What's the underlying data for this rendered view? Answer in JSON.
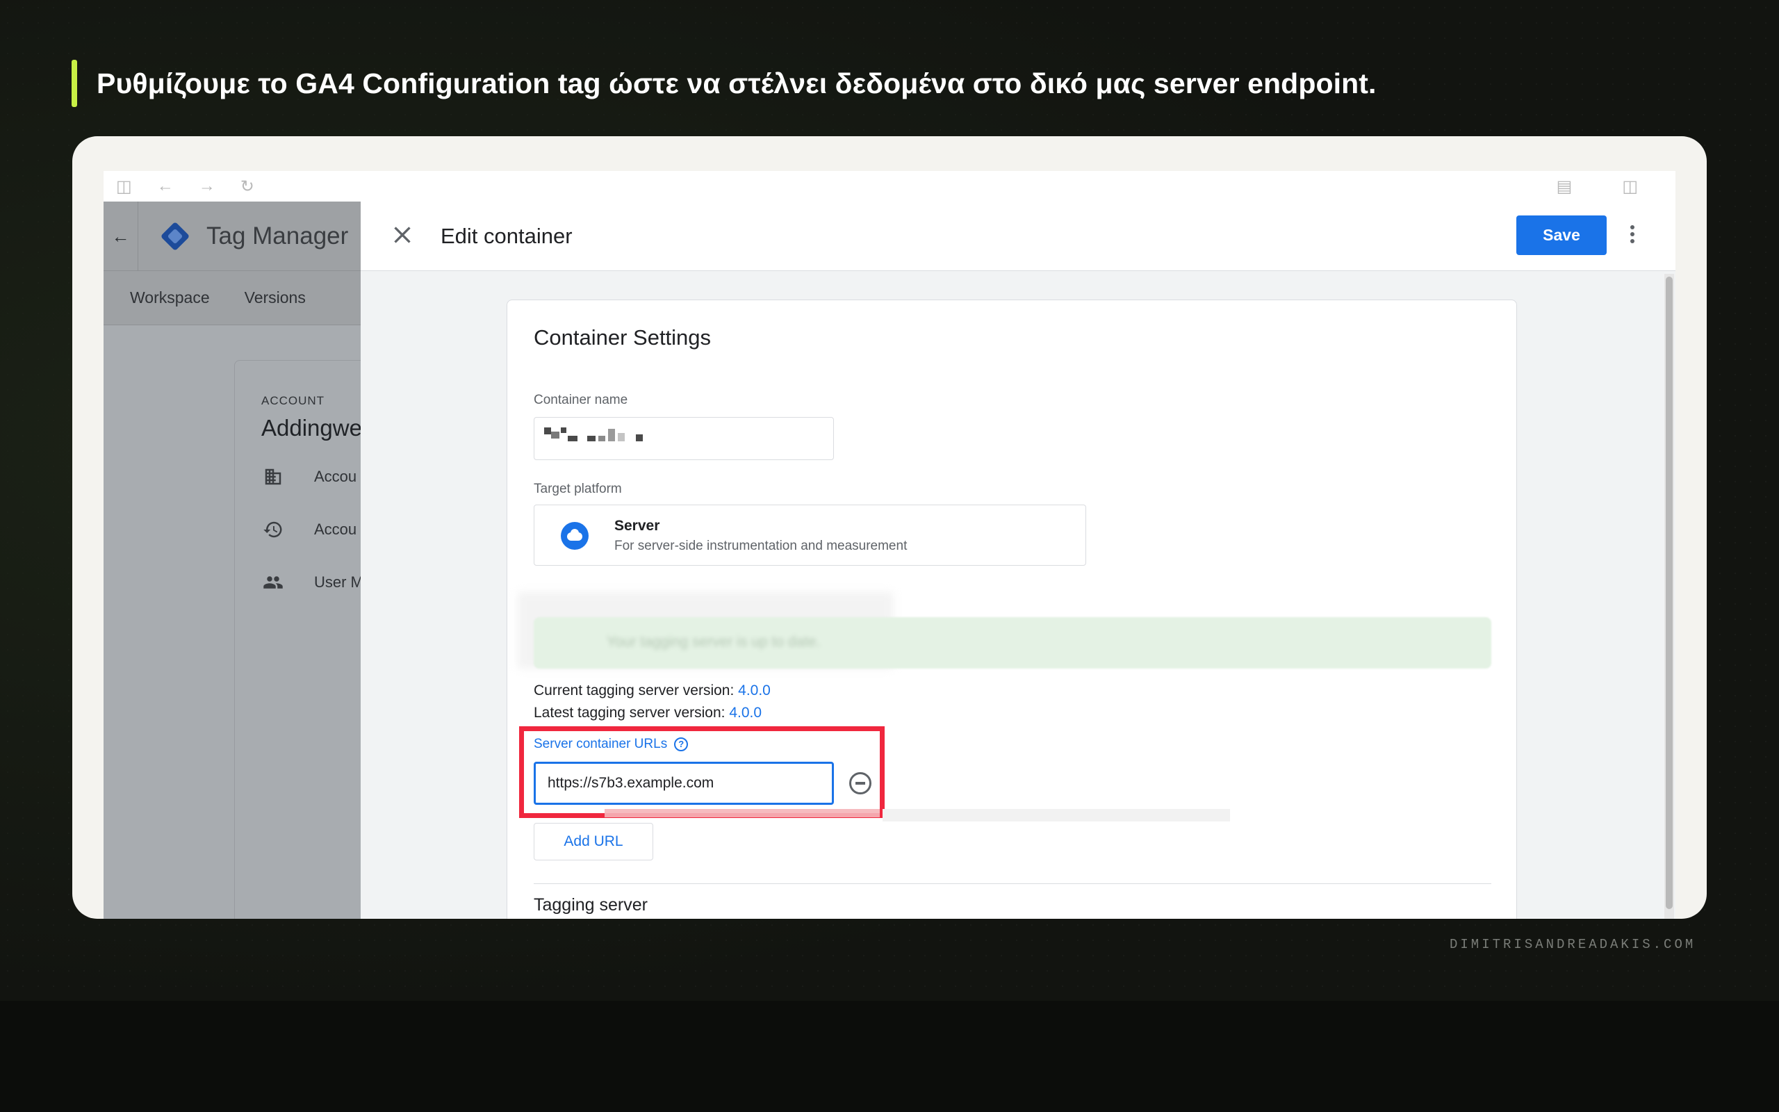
{
  "headline": "Ρυθμίζουμε το GA4 Configuration tag ώστε να στέλνει δεδομένα στο δικό μας server endpoint.",
  "watermark": "DIMITRISANDREADAKIS.COM",
  "colors": {
    "accent_bar": "#c8f045",
    "primary_blue": "#1a73e8",
    "highlight_red": "#f0273e"
  },
  "browser": {
    "toolbar_icons": [
      "sidebar-icon",
      "back-arrow-icon",
      "forward-arrow-icon",
      "reload-icon",
      "extensions-icon",
      "reader-icon"
    ]
  },
  "background_app": {
    "app_name": "Tag Manager",
    "tabs": [
      "Workspace",
      "Versions"
    ],
    "account_label": "ACCOUNT",
    "account_name": "Addingwe",
    "menu": [
      {
        "icon": "building-icon",
        "label": "Accou"
      },
      {
        "icon": "history-icon",
        "label": "Accou"
      },
      {
        "icon": "users-icon",
        "label": "User M"
      }
    ]
  },
  "edit_panel": {
    "title": "Edit container",
    "save_label": "Save",
    "settings": {
      "heading": "Container Settings",
      "container_name_label": "Container name",
      "target_platform_label": "Target platform",
      "platform_name": "Server",
      "platform_description": "For server-side instrumentation and measurement",
      "banner_text": "Your tagging server is up to date.",
      "current_version_label": "Current tagging server version:",
      "current_version": "4.0.0",
      "latest_version_label": "Latest tagging server version:",
      "latest_version": "4.0.0",
      "urls_label": "Server container URLs",
      "url_value": "https://s7b3.example.com",
      "add_url_label": "Add URL",
      "next_section": "Tagging server"
    }
  }
}
